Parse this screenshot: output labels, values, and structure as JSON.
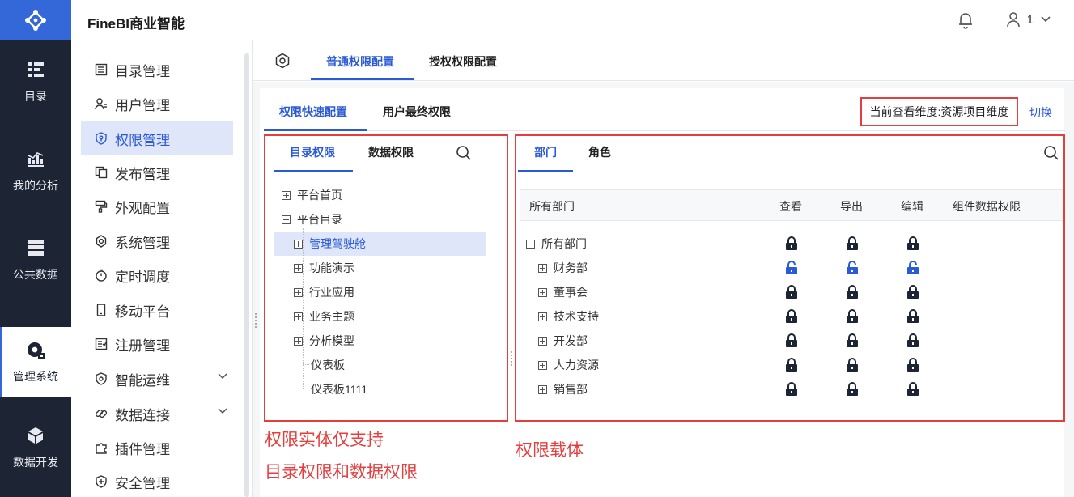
{
  "app": {
    "title": "FineBI商业智能"
  },
  "header": {
    "user_label": "1"
  },
  "rail": {
    "items": [
      {
        "label": "目录",
        "icon": "catalog-icon"
      },
      {
        "label": "我的分析",
        "icon": "analysis-icon"
      },
      {
        "label": "公共数据",
        "icon": "database-icon"
      },
      {
        "label": "管理系统",
        "icon": "management-icon",
        "active": true
      },
      {
        "label": "数据开发",
        "icon": "data-dev-icon"
      }
    ]
  },
  "sidebar": {
    "items": [
      {
        "label": "目录管理",
        "icon": "list-icon"
      },
      {
        "label": "用户管理",
        "icon": "user-icon"
      },
      {
        "label": "权限管理",
        "icon": "shield-icon",
        "active": true
      },
      {
        "label": "发布管理",
        "icon": "copy-icon"
      },
      {
        "label": "外观配置",
        "icon": "paint-icon"
      },
      {
        "label": "系统管理",
        "icon": "gear-icon"
      },
      {
        "label": "定时调度",
        "icon": "timer-icon"
      },
      {
        "label": "移动平台",
        "icon": "mobile-icon"
      },
      {
        "label": "注册管理",
        "icon": "register-icon"
      },
      {
        "label": "智能运维",
        "icon": "ops-icon",
        "expandable": true
      },
      {
        "label": "数据连接",
        "icon": "link-icon",
        "expandable": true
      },
      {
        "label": "插件管理",
        "icon": "plugin-icon"
      },
      {
        "label": "安全管理",
        "icon": "security-icon"
      }
    ]
  },
  "top_tabs": {
    "normal": "普通权限配置",
    "grant": "授权权限配置"
  },
  "sub_tabs": {
    "quick": "权限快速配置",
    "final": "用户最终权限"
  },
  "dimension": {
    "label": "当前查看维度:资源项目维度",
    "switch": "切换"
  },
  "left_panel": {
    "tabs": {
      "catalog": "目录权限",
      "data": "数据权限"
    },
    "tree": [
      {
        "label": "平台首页",
        "level": 0,
        "toggle": "plus"
      },
      {
        "label": "平台目录",
        "level": 0,
        "toggle": "minus"
      },
      {
        "label": "管理驾驶舱",
        "level": 1,
        "toggle": "plus",
        "selected": true
      },
      {
        "label": "功能演示",
        "level": 1,
        "toggle": "plus"
      },
      {
        "label": "行业应用",
        "level": 1,
        "toggle": "plus"
      },
      {
        "label": "业务主题",
        "level": 1,
        "toggle": "plus"
      },
      {
        "label": "分析模型",
        "level": 1,
        "toggle": "plus"
      },
      {
        "label": "仪表板",
        "level": 1,
        "toggle": "none"
      },
      {
        "label": "仪表板1111",
        "level": 1,
        "toggle": "none"
      }
    ]
  },
  "right_panel": {
    "tabs": {
      "dept": "部门",
      "role": "角色"
    },
    "columns": [
      "所有部门",
      "查看",
      "导出",
      "编辑",
      "组件数据权限"
    ],
    "rows": [
      {
        "label": "所有部门",
        "level": 0,
        "toggle": "minus",
        "locks": [
          "locked",
          "locked",
          "locked"
        ]
      },
      {
        "label": "财务部",
        "level": 1,
        "toggle": "plus",
        "locks": [
          "unlocked",
          "unlocked",
          "unlocked"
        ]
      },
      {
        "label": "董事会",
        "level": 1,
        "toggle": "plus",
        "locks": [
          "locked",
          "locked",
          "locked"
        ]
      },
      {
        "label": "技术支持",
        "level": 1,
        "toggle": "plus",
        "locks": [
          "locked",
          "locked",
          "locked"
        ]
      },
      {
        "label": "开发部",
        "level": 1,
        "toggle": "plus",
        "locks": [
          "locked",
          "locked",
          "locked"
        ]
      },
      {
        "label": "人力资源",
        "level": 1,
        "toggle": "plus",
        "locks": [
          "locked",
          "locked",
          "locked"
        ]
      },
      {
        "label": "销售部",
        "level": 1,
        "toggle": "plus",
        "locks": [
          "locked",
          "locked",
          "locked"
        ]
      }
    ]
  },
  "annotations": {
    "left_line1": "权限实体仅支持",
    "left_line2": "目录权限和数据权限",
    "right": "权限载体"
  },
  "colors": {
    "accent": "#2a5ad6",
    "rail": "#1d2434",
    "annotation": "#e53e3e",
    "locked": "#1d2434",
    "unlocked": "#2a5ad6"
  }
}
